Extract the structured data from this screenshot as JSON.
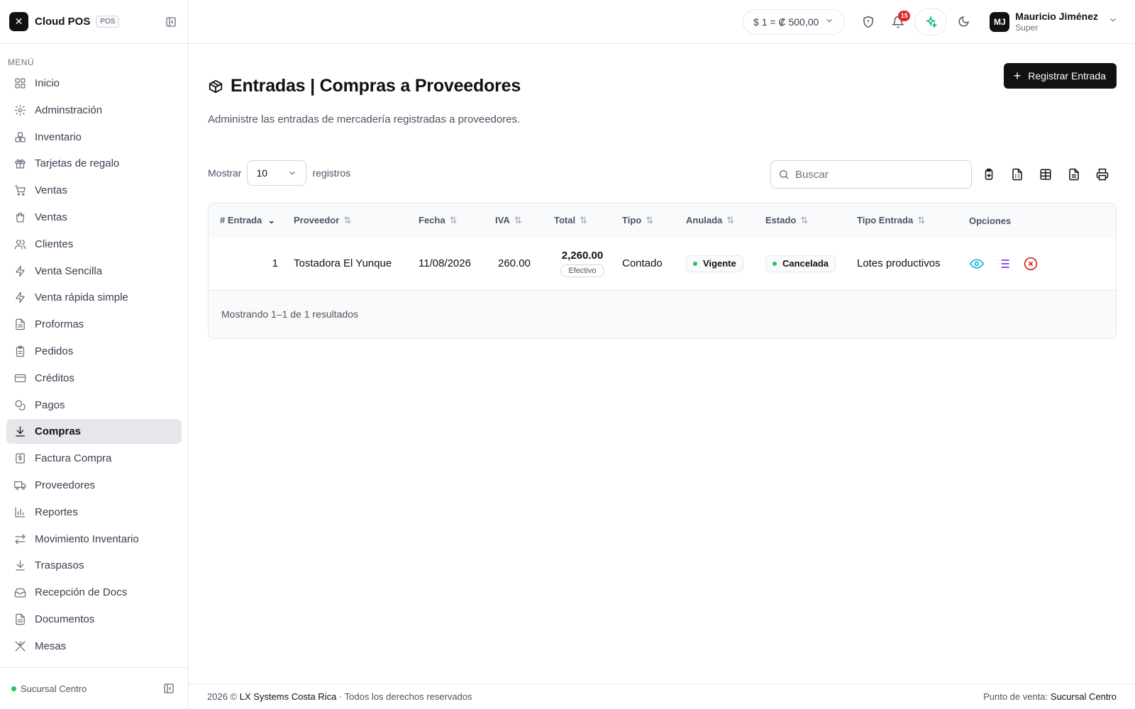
{
  "app": {
    "name": "Cloud POS",
    "badge": "POS"
  },
  "sidebar": {
    "menu_label": "MENÚ",
    "items": [
      {
        "label": "Inicio",
        "icon": "grid-icon"
      },
      {
        "label": "Adminstración",
        "icon": "gear-icon"
      },
      {
        "label": "Inventario",
        "icon": "boxes-icon"
      },
      {
        "label": "Tarjetas de regalo",
        "icon": "gift-icon"
      },
      {
        "label": "Ventas",
        "icon": "cart-icon"
      },
      {
        "label": "Ventas",
        "icon": "shopping-bag-icon"
      },
      {
        "label": "Clientes",
        "icon": "users-icon"
      },
      {
        "label": "Venta Sencilla",
        "icon": "bolt-icon"
      },
      {
        "label": "Venta rápida simple",
        "icon": "bolt-icon"
      },
      {
        "label": "Proformas",
        "icon": "document-icon"
      },
      {
        "label": "Pedidos",
        "icon": "clipboard-icon"
      },
      {
        "label": "Créditos",
        "icon": "credit-card-icon"
      },
      {
        "label": "Pagos",
        "icon": "coins-icon"
      },
      {
        "label": "Compras",
        "icon": "download-icon",
        "active": true
      },
      {
        "label": "Factura Compra",
        "icon": "receipt-icon"
      },
      {
        "label": "Proveedores",
        "icon": "truck-icon"
      },
      {
        "label": "Reportes",
        "icon": "bar-chart-icon"
      },
      {
        "label": "Movimiento Inventario",
        "icon": "arrows-icon"
      },
      {
        "label": "Traspasos",
        "icon": "download-icon"
      },
      {
        "label": "Recepción de Docs",
        "icon": "inbox-icon"
      },
      {
        "label": "Documentos",
        "icon": "document-icon"
      },
      {
        "label": "Mesas",
        "icon": "utensils-icon"
      }
    ],
    "branch": "Sucursal Centro"
  },
  "topbar": {
    "exchange_rate": "$ 1 =  ₡ 500,00",
    "notification_count": "15",
    "user": {
      "initials": "MJ",
      "name": "Mauricio Jiménez",
      "role": "Super"
    }
  },
  "page": {
    "title": "Entradas | Compras a Proveedores",
    "description": "Administre las entradas de mercadería registradas a proveedores.",
    "primary_button": "Registrar Entrada"
  },
  "controls": {
    "show_label": "Mostrar",
    "page_size": "10",
    "records_label": "registros",
    "search_placeholder": "Buscar"
  },
  "table": {
    "columns": [
      "# Entrada",
      "Proveedor",
      "Fecha",
      "IVA",
      "Total",
      "Tipo",
      "Anulada",
      "Estado",
      "Tipo Entrada",
      "Opciones"
    ],
    "rows": [
      {
        "entrada": "1",
        "proveedor": "Tostadora El Yunque",
        "fecha": "11/08/2026",
        "iva": "260.00",
        "total": "2,260.00",
        "pago": "Efectivo",
        "tipo": "Contado",
        "anulada": "Vigente",
        "estado": "Cancelada",
        "tipo_entrada": "Lotes productivos"
      }
    ],
    "summary": "Mostrando 1–1 de 1 resultados"
  },
  "footer": {
    "year": "2026 ©",
    "company": "LX Systems Costa Rica",
    "rights": "· Todos los derechos reservados",
    "pos_label": "Punto de venta:",
    "pos_value": "Sucursal Centro"
  },
  "colors": {
    "accent": "#111111",
    "success": "#22c55e",
    "danger": "#dc2626",
    "view": "#06b6d4",
    "list": "#7c3aed",
    "ai": "#10b981"
  }
}
